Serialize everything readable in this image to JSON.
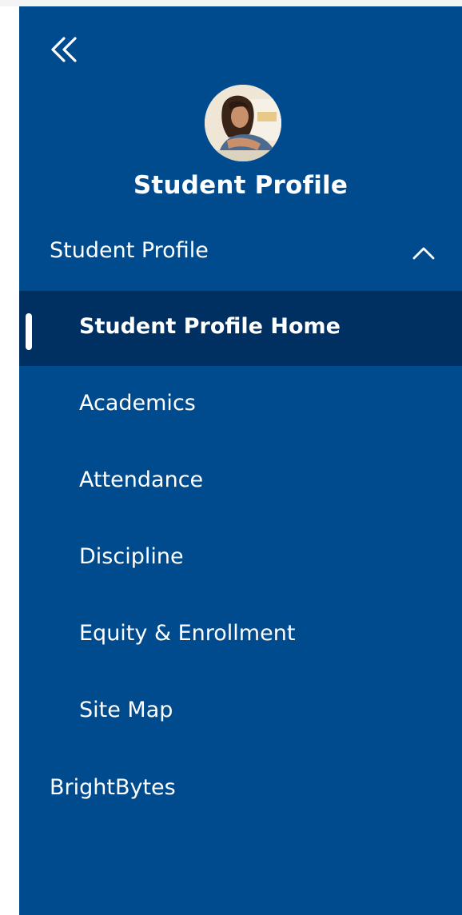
{
  "sidebar": {
    "collapse_icon": "double-chevron-left-icon",
    "profile": {
      "avatar_icon": "avatar-student-photo",
      "title": "Student Profile"
    },
    "section": {
      "label": "Student Profile",
      "expanded": true,
      "chevron_icon": "chevron-up-icon"
    },
    "items": [
      {
        "label": "Student Profile Home",
        "active": true
      },
      {
        "label": "Academics",
        "active": false
      },
      {
        "label": "Attendance",
        "active": false
      },
      {
        "label": "Discipline",
        "active": false
      },
      {
        "label": "Equity & Enrollment",
        "active": false
      },
      {
        "label": "Site Map",
        "active": false
      }
    ],
    "bottom_item": {
      "label": "BrightBytes"
    }
  },
  "colors": {
    "sidebar_bg": "#004b8d",
    "active_bg": "#002f62",
    "text": "#ffffff"
  }
}
